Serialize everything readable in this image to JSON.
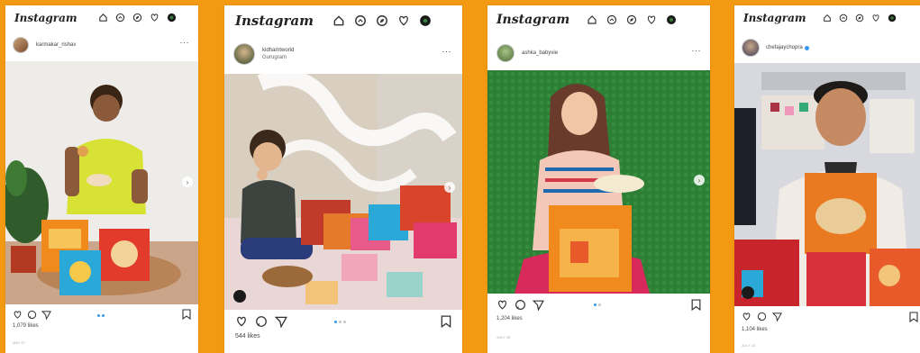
{
  "brand": {
    "app_name": "Instagram",
    "accent": "#f39a12",
    "link_blue": "#3897f0"
  },
  "posts": [
    {
      "username": "karmakar_rishav",
      "location": "",
      "likes": "1,079 likes",
      "date": "MAY 27"
    },
    {
      "username": "kidhamtworld",
      "location": "Gurugram",
      "likes": "544 likes",
      "date": ""
    },
    {
      "username": "ashka_babyvie",
      "location": "",
      "likes": "1,204 likes",
      "date": "JULY 28"
    },
    {
      "username": "chefajaychopra",
      "location": "",
      "likes": "1,104 likes",
      "date": "JULY 15"
    }
  ],
  "icons": [
    "home-icon",
    "messenger-icon",
    "explore-icon",
    "heart-icon",
    "profile-icon",
    "comment-icon",
    "share-icon",
    "bookmark-icon",
    "more-icon",
    "user-tag-icon"
  ]
}
